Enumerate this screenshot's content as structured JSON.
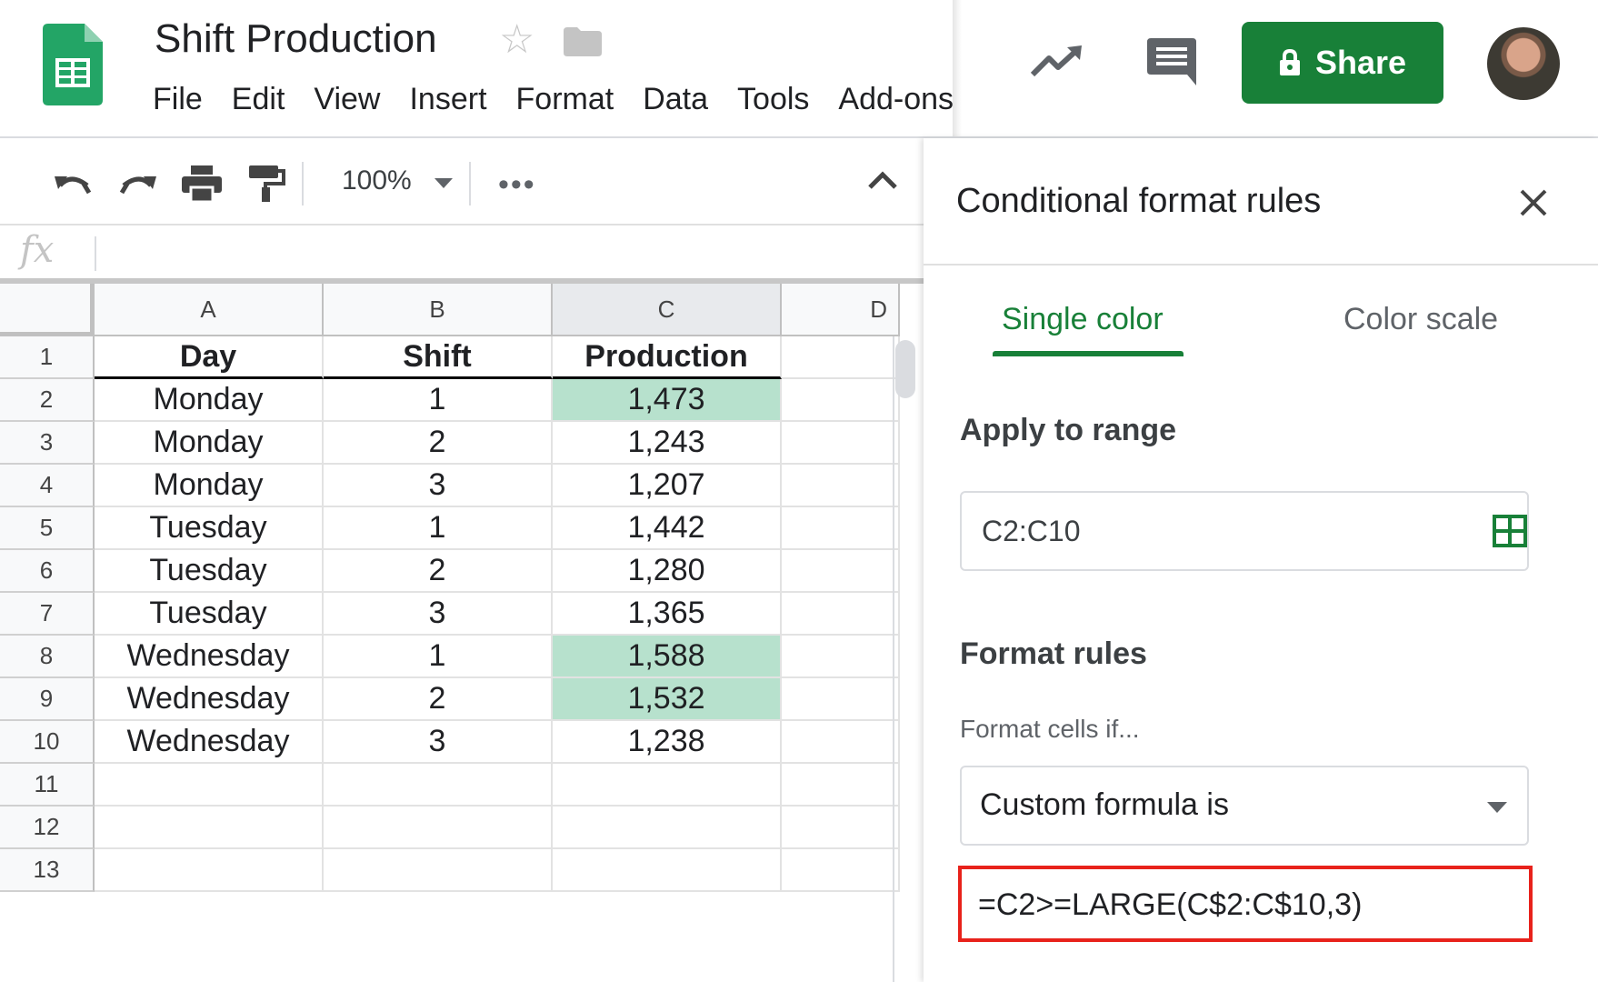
{
  "app": {
    "doc_title": "Shift Production",
    "menu": [
      "File",
      "Edit",
      "View",
      "Insert",
      "Format",
      "Data",
      "Tools",
      "Add-ons"
    ],
    "share_label": "Share"
  },
  "toolbar": {
    "zoom": "100%",
    "icons": [
      "undo-icon",
      "redo-icon",
      "print-icon",
      "paint-format-icon",
      "more-icon",
      "collapse-icon"
    ]
  },
  "formula_bar": {
    "fx_label": "fx",
    "value": ""
  },
  "sheet": {
    "columns": [
      "A",
      "B",
      "C",
      "D"
    ],
    "rows": [
      {
        "num": "1",
        "a": "Day",
        "b": "Shift",
        "c": "Production",
        "highlight": false,
        "header": true
      },
      {
        "num": "2",
        "a": "Monday",
        "b": "1",
        "c": "1,473",
        "highlight": true
      },
      {
        "num": "3",
        "a": "Monday",
        "b": "2",
        "c": "1,243",
        "highlight": false
      },
      {
        "num": "4",
        "a": "Monday",
        "b": "3",
        "c": "1,207",
        "highlight": false
      },
      {
        "num": "5",
        "a": "Tuesday",
        "b": "1",
        "c": "1,442",
        "highlight": false
      },
      {
        "num": "6",
        "a": "Tuesday",
        "b": "2",
        "c": "1,280",
        "highlight": false
      },
      {
        "num": "7",
        "a": "Tuesday",
        "b": "3",
        "c": "1,365",
        "highlight": false
      },
      {
        "num": "8",
        "a": "Wednesday",
        "b": "1",
        "c": "1,588",
        "highlight": true
      },
      {
        "num": "9",
        "a": "Wednesday",
        "b": "2",
        "c": "1,532",
        "highlight": true
      },
      {
        "num": "10",
        "a": "Wednesday",
        "b": "3",
        "c": "1,238",
        "highlight": false
      },
      {
        "num": "11",
        "a": "",
        "b": "",
        "c": "",
        "highlight": false
      },
      {
        "num": "12",
        "a": "",
        "b": "",
        "c": "",
        "highlight": false
      },
      {
        "num": "13",
        "a": "",
        "b": "",
        "c": "",
        "highlight": false
      }
    ],
    "highlight_color": "#b7e1cd"
  },
  "panel": {
    "title": "Conditional format rules",
    "tabs": [
      "Single color",
      "Color scale"
    ],
    "active_tab": "Single color",
    "apply_to_range_label": "Apply to range",
    "range": "C2:C10",
    "format_rules_label": "Format rules",
    "format_cells_if_label": "Format cells if...",
    "condition": "Custom formula is",
    "formula": "=C2>=LARGE(C$2:C$10,3)"
  },
  "colors": {
    "brand_green": "#188038",
    "highlight_border": "#e8221b"
  }
}
